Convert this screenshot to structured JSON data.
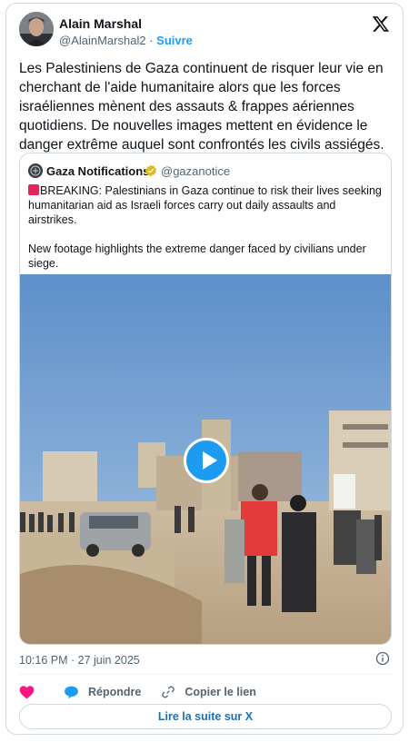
{
  "author": {
    "name": "Alain Marshal",
    "handle": "@AlainMarshal2",
    "separator": "·",
    "follow_label": "Suivre"
  },
  "tweet": {
    "text": "Les Palestiniens de Gaza continuent de risquer leur vie en cherchant de l'aide humanitaire alors que les forces israéliennes mènent des assauts & frappes aériennes quotidiens.  De nouvelles images mettent en évidence le danger extrême auquel sont confrontés les civils assiégés.",
    "timestamp": "10:16 PM · 27 juin 2025"
  },
  "quote": {
    "name": "Gaza Notifications",
    "handle": "@gazanotice",
    "verified": true,
    "paragraph1": "BREAKING: Palestinians in Gaza continue to risk their lives seeking humanitarian aid as Israeli forces carry out daily assaults and airstrikes.",
    "paragraph2": "New footage highlights the extreme danger faced by civilians under siege.",
    "media_type": "video"
  },
  "actions": {
    "like_icon": "heart-icon",
    "reply_label": "Répondre",
    "copy_label": "Copier le lien"
  },
  "read_more_label": "Lire la suite sur X",
  "colors": {
    "accent": "#1d9bf0",
    "like": "#f91880",
    "text": "#0f1419",
    "muted": "#536471"
  }
}
